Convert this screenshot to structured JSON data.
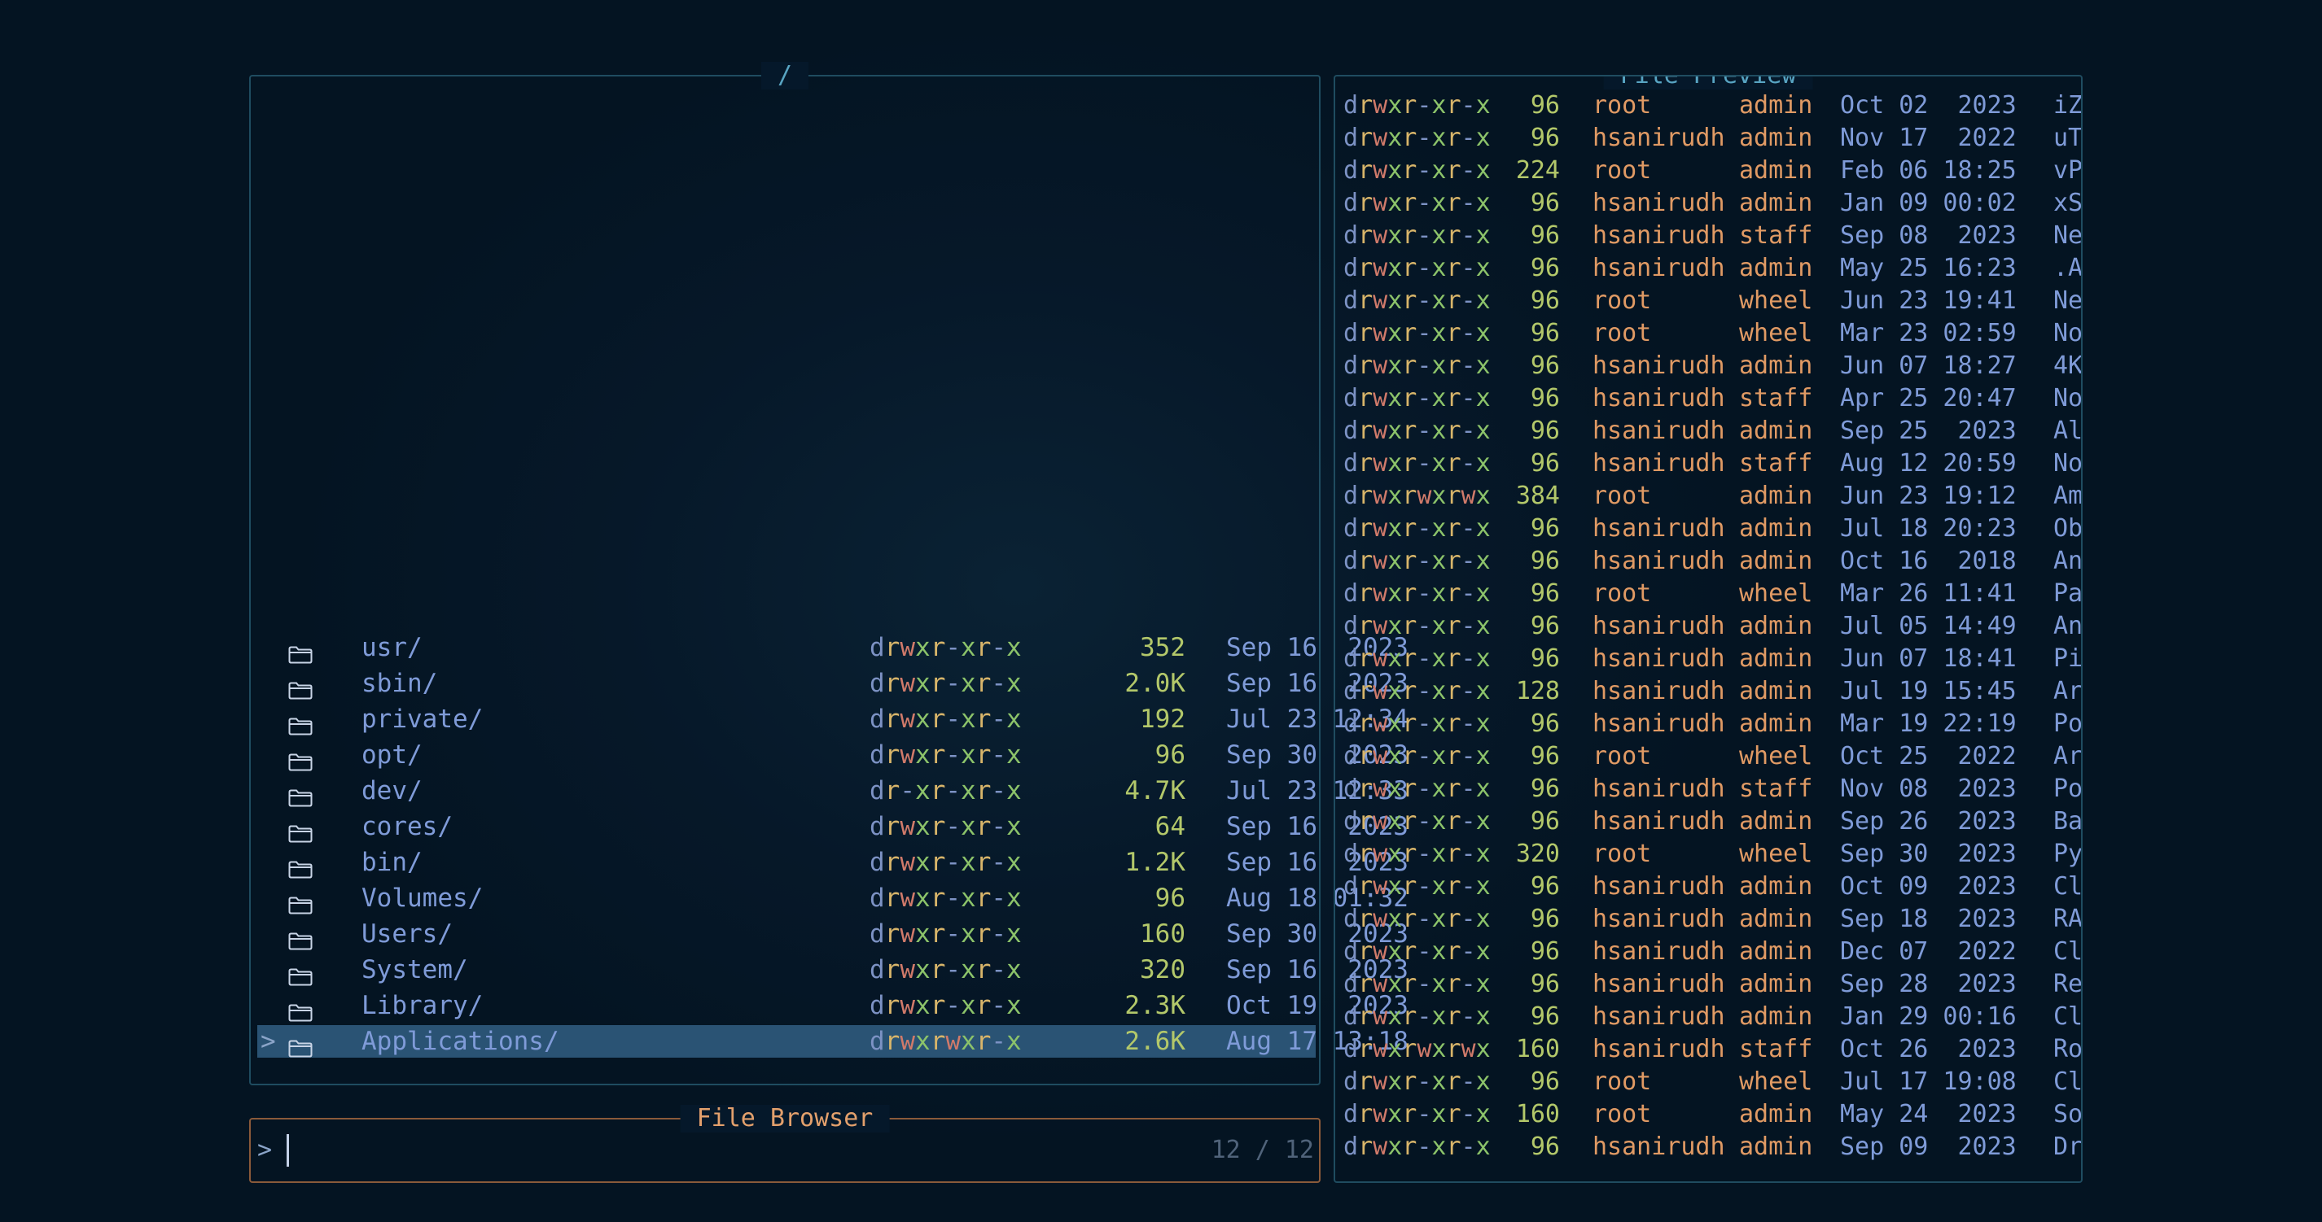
{
  "browser": {
    "title": "/",
    "files": [
      {
        "name": "usr/",
        "perm": "drwxr-xr-x",
        "size": "352",
        "date": "Sep 16  2023",
        "selected": false
      },
      {
        "name": "sbin/",
        "perm": "drwxr-xr-x",
        "size": "2.0K",
        "date": "Sep 16  2023",
        "selected": false
      },
      {
        "name": "private/",
        "perm": "drwxr-xr-x",
        "size": "192",
        "date": "Jul 23 12:34",
        "selected": false
      },
      {
        "name": "opt/",
        "perm": "drwxr-xr-x",
        "size": "96",
        "date": "Sep 30  2023",
        "selected": false
      },
      {
        "name": "dev/",
        "perm": "dr-xr-xr-x",
        "size": "4.7K",
        "date": "Jul 23 12:33",
        "selected": false
      },
      {
        "name": "cores/",
        "perm": "drwxr-xr-x",
        "size": "64",
        "date": "Sep 16  2023",
        "selected": false
      },
      {
        "name": "bin/",
        "perm": "drwxr-xr-x",
        "size": "1.2K",
        "date": "Sep 16  2023",
        "selected": false
      },
      {
        "name": "Volumes/",
        "perm": "drwxr-xr-x",
        "size": "96",
        "date": "Aug 18 01:32",
        "selected": false
      },
      {
        "name": "Users/",
        "perm": "drwxr-xr-x",
        "size": "160",
        "date": "Sep 30  2023",
        "selected": false
      },
      {
        "name": "System/",
        "perm": "drwxr-xr-x",
        "size": "320",
        "date": "Sep 16  2023",
        "selected": false
      },
      {
        "name": "Library/",
        "perm": "drwxr-xr-x",
        "size": "2.3K",
        "date": "Oct 19  2023",
        "selected": false
      },
      {
        "name": "Applications/",
        "perm": "drwxrwxr-x",
        "size": "2.6K",
        "date": "Aug 17 13:18",
        "selected": true
      }
    ],
    "cursor_symbol": ">",
    "icon": "folder-icon"
  },
  "prompt": {
    "title": "File Browser",
    "symbol": ">",
    "value": "",
    "placeholder": "",
    "count": "12 / 12"
  },
  "preview": {
    "title": "File Preview",
    "rows": [
      {
        "perm": "drwxr-xr-x",
        "size": "96",
        "owner": "root",
        "group": "admin",
        "date": "Oct 02  2023",
        "name": "iZ"
      },
      {
        "perm": "drwxr-xr-x",
        "size": "96",
        "owner": "hsanirudh",
        "group": "admin",
        "date": "Nov 17  2022",
        "name": "uT"
      },
      {
        "perm": "drwxr-xr-x",
        "size": "224",
        "owner": "root",
        "group": "admin",
        "date": "Feb 06 18:25",
        "name": "vP"
      },
      {
        "perm": "drwxr-xr-x",
        "size": "96",
        "owner": "hsanirudh",
        "group": "admin",
        "date": "Jan 09 00:02",
        "name": "xS"
      },
      {
        "perm": "drwxr-xr-x",
        "size": "96",
        "owner": "hsanirudh",
        "group": "staff",
        "date": "Sep 08  2023",
        "name": "Ne"
      },
      {
        "perm": "drwxr-xr-x",
        "size": "96",
        "owner": "hsanirudh",
        "group": "admin",
        "date": "May 25 16:23",
        "name": ".A"
      },
      {
        "perm": "drwxr-xr-x",
        "size": "96",
        "owner": "root",
        "group": "wheel",
        "date": "Jun 23 19:41",
        "name": "Ne"
      },
      {
        "perm": "drwxr-xr-x",
        "size": "96",
        "owner": "root",
        "group": "wheel",
        "date": "Mar 23 02:59",
        "name": "No"
      },
      {
        "perm": "drwxr-xr-x",
        "size": "96",
        "owner": "hsanirudh",
        "group": "admin",
        "date": "Jun 07 18:27",
        "name": "4K"
      },
      {
        "perm": "drwxr-xr-x",
        "size": "96",
        "owner": "hsanirudh",
        "group": "staff",
        "date": "Apr 25 20:47",
        "name": "No"
      },
      {
        "perm": "drwxr-xr-x",
        "size": "96",
        "owner": "hsanirudh",
        "group": "admin",
        "date": "Sep 25  2023",
        "name": "Al"
      },
      {
        "perm": "drwxr-xr-x",
        "size": "96",
        "owner": "hsanirudh",
        "group": "staff",
        "date": "Aug 12 20:59",
        "name": "No"
      },
      {
        "perm": "drwxrwxrwx",
        "size": "384",
        "owner": "root",
        "group": "admin",
        "date": "Jun 23 19:12",
        "name": "Am"
      },
      {
        "perm": "drwxr-xr-x",
        "size": "96",
        "owner": "hsanirudh",
        "group": "admin",
        "date": "Jul 18 20:23",
        "name": "Ob"
      },
      {
        "perm": "drwxr-xr-x",
        "size": "96",
        "owner": "hsanirudh",
        "group": "admin",
        "date": "Oct 16  2018",
        "name": "An"
      },
      {
        "perm": "drwxr-xr-x",
        "size": "96",
        "owner": "root",
        "group": "wheel",
        "date": "Mar 26 11:41",
        "name": "Pa"
      },
      {
        "perm": "drwxr-xr-x",
        "size": "96",
        "owner": "hsanirudh",
        "group": "admin",
        "date": "Jul 05 14:49",
        "name": "An"
      },
      {
        "perm": "drwxr-xr-x",
        "size": "96",
        "owner": "hsanirudh",
        "group": "admin",
        "date": "Jun 07 18:41",
        "name": "Pi"
      },
      {
        "perm": "drwxr-xr-x",
        "size": "128",
        "owner": "hsanirudh",
        "group": "admin",
        "date": "Jul 19 15:45",
        "name": "Ar"
      },
      {
        "perm": "drwxr-xr-x",
        "size": "96",
        "owner": "hsanirudh",
        "group": "admin",
        "date": "Mar 19 22:19",
        "name": "Po"
      },
      {
        "perm": "drwxr-xr-x",
        "size": "96",
        "owner": "root",
        "group": "wheel",
        "date": "Oct 25  2022",
        "name": "Ar"
      },
      {
        "perm": "drwxr-xr-x",
        "size": "96",
        "owner": "hsanirudh",
        "group": "staff",
        "date": "Nov 08  2023",
        "name": "Po"
      },
      {
        "perm": "drwxr-xr-x",
        "size": "96",
        "owner": "hsanirudh",
        "group": "admin",
        "date": "Sep 26  2023",
        "name": "Ba"
      },
      {
        "perm": "drwxr-xr-x",
        "size": "320",
        "owner": "root",
        "group": "wheel",
        "date": "Sep 30  2023",
        "name": "Py"
      },
      {
        "perm": "drwxr-xr-x",
        "size": "96",
        "owner": "hsanirudh",
        "group": "admin",
        "date": "Oct 09  2023",
        "name": "Cl"
      },
      {
        "perm": "drwxr-xr-x",
        "size": "96",
        "owner": "hsanirudh",
        "group": "admin",
        "date": "Sep 18  2023",
        "name": "RA"
      },
      {
        "perm": "drwxr-xr-x",
        "size": "96",
        "owner": "hsanirudh",
        "group": "admin",
        "date": "Dec 07  2022",
        "name": "Cl"
      },
      {
        "perm": "drwxr-xr-x",
        "size": "96",
        "owner": "hsanirudh",
        "group": "admin",
        "date": "Sep 28  2023",
        "name": "Re"
      },
      {
        "perm": "drwxr-xr-x",
        "size": "96",
        "owner": "hsanirudh",
        "group": "admin",
        "date": "Jan 29 00:16",
        "name": "Cl"
      },
      {
        "perm": "drwxrwxrwx",
        "size": "160",
        "owner": "hsanirudh",
        "group": "staff",
        "date": "Oct 26  2023",
        "name": "Ro"
      },
      {
        "perm": "drwxr-xr-x",
        "size": "96",
        "owner": "root",
        "group": "wheel",
        "date": "Jul 17 19:08",
        "name": "Cl"
      },
      {
        "perm": "drwxr-xr-x",
        "size": "160",
        "owner": "root",
        "group": "admin",
        "date": "May 24  2023",
        "name": "So"
      },
      {
        "perm": "drwxr-xr-x",
        "size": "96",
        "owner": "hsanirudh",
        "group": "admin",
        "date": "Sep 09  2023",
        "name": "Dr"
      }
    ]
  },
  "colors": {
    "background": "#041422",
    "selected_row": "#2a5374",
    "pane_border": "#1f4c60",
    "prompt_border": "#8a5a3a",
    "title_blue": "#58a4c2",
    "title_orange": "#e3a06c"
  }
}
